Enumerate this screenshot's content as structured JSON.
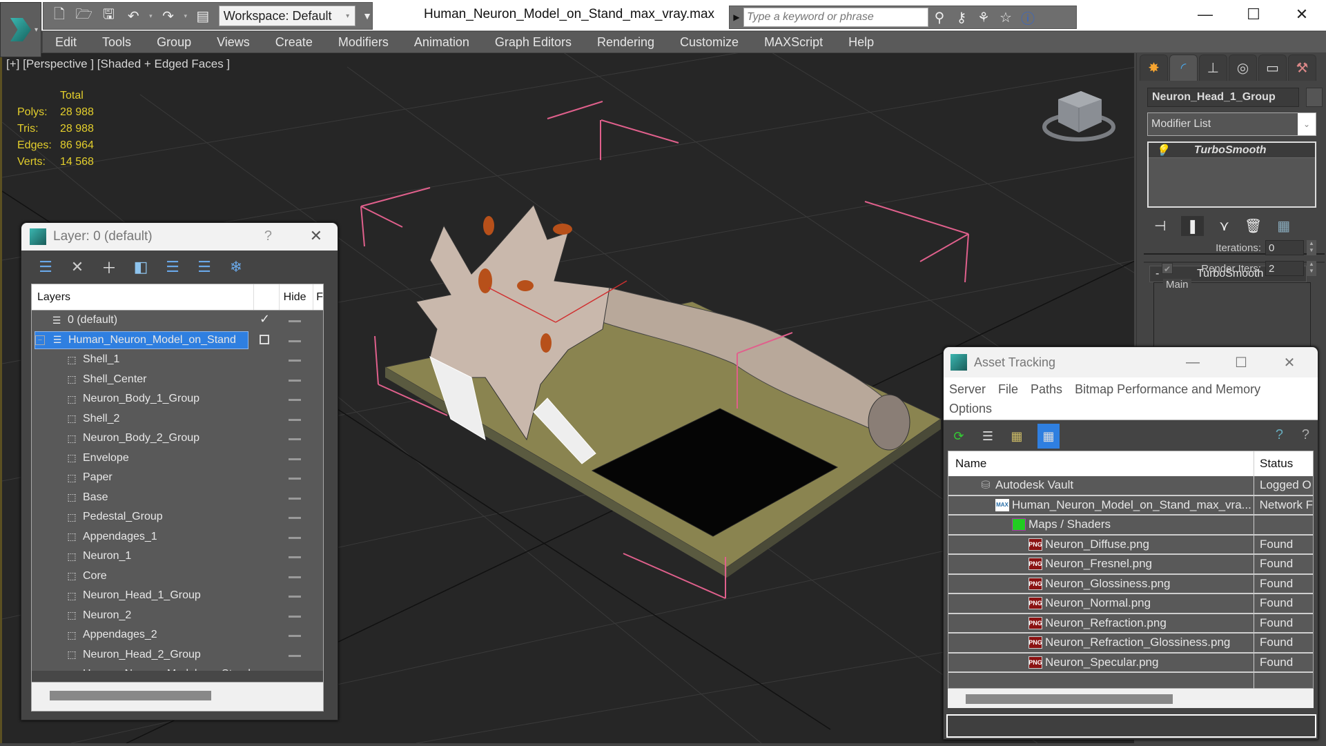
{
  "titlebar": {
    "workspace_label": "Workspace: Default",
    "document_title": "Human_Neuron_Model_on_Stand_max_vray.max",
    "search_placeholder": "Type a keyword or phrase",
    "minimize": "—",
    "maximize": "☐",
    "close": "✕"
  },
  "menubar": [
    "Edit",
    "Tools",
    "Group",
    "Views",
    "Create",
    "Modifiers",
    "Animation",
    "Graph Editors",
    "Rendering",
    "Customize",
    "MAXScript",
    "Help"
  ],
  "viewport": {
    "label": "[+] [Perspective ] [Shaded + Edged Faces ]",
    "stats": {
      "header": "Total",
      "rows": [
        {
          "label": "Polys:",
          "value": "28 988"
        },
        {
          "label": "Tris:",
          "value": "28 988"
        },
        {
          "label": "Edges:",
          "value": "86 964"
        },
        {
          "label": "Verts:",
          "value": "14 568"
        }
      ]
    },
    "colors": {
      "stats": "#e4cf2c",
      "selection_bracket": "#e0608c",
      "background": "#262626"
    }
  },
  "layer_panel": {
    "title": "Layer: 0 (default)",
    "help": "?",
    "close": "✕",
    "toolbar_icons": [
      "create-layer-icon",
      "delete-layer-icon",
      "add-to-layer-icon",
      "select-objects-icon",
      "select-layer-icon",
      "set-current-layer-icon",
      "freeze-layer-icon"
    ],
    "columns": {
      "layers": "Layers",
      "hide": "Hide",
      "freeze": "F"
    },
    "rows": [
      {
        "name": "0 (default)",
        "type": "layer",
        "current": true
      },
      {
        "name": "Human_Neuron_Model_on_Stand",
        "type": "layer",
        "selected": true,
        "expanded": true
      },
      {
        "name": "Shell_1",
        "type": "object"
      },
      {
        "name": "Shell_Center",
        "type": "object"
      },
      {
        "name": "Neuron_Body_1_Group",
        "type": "object"
      },
      {
        "name": "Shell_2",
        "type": "object"
      },
      {
        "name": "Neuron_Body_2_Group",
        "type": "object"
      },
      {
        "name": "Envelope",
        "type": "object"
      },
      {
        "name": "Paper",
        "type": "object"
      },
      {
        "name": "Base",
        "type": "object"
      },
      {
        "name": "Pedestal_Group",
        "type": "object"
      },
      {
        "name": "Appendages_1",
        "type": "object"
      },
      {
        "name": "Neuron_1",
        "type": "object"
      },
      {
        "name": "Core",
        "type": "object"
      },
      {
        "name": "Neuron_Head_1_Group",
        "type": "object"
      },
      {
        "name": "Neuron_2",
        "type": "object"
      },
      {
        "name": "Appendages_2",
        "type": "object"
      },
      {
        "name": "Neuron_Head_2_Group",
        "type": "object"
      },
      {
        "name": "Human_Neuron_Model_on_Stand",
        "type": "object"
      }
    ]
  },
  "command_panel": {
    "tabs": [
      "create-tab",
      "modify-tab",
      "hierarchy-tab",
      "motion-tab",
      "display-tab",
      "utilities-tab"
    ],
    "active_tab": "modify-tab",
    "object_name": "Neuron_Head_1_Group",
    "modifier_list_label": "Modifier List",
    "modifier_stack": [
      "TurboSmooth"
    ],
    "rollout_title": "TurboSmooth",
    "rollout_collapse": "-",
    "group_label": "Main",
    "iterations_label": "Iterations:",
    "iterations_value": "0",
    "render_iters_label": "Render Iters:",
    "render_iters_value": "2",
    "render_iters_checked": true
  },
  "asset_tracking": {
    "title": "Asset Tracking",
    "menu_row1": [
      "Server",
      "File",
      "Paths",
      "Bitmap Performance and Memory"
    ],
    "menu_row2": [
      "Options"
    ],
    "columns": {
      "name": "Name",
      "status": "Status"
    },
    "rows": [
      {
        "name": "Autodesk Vault",
        "status": "Logged O",
        "icon": "vault",
        "indent": 1
      },
      {
        "name": "Human_Neuron_Model_on_Stand_max_vra...",
        "status": "Network F",
        "icon": "max",
        "indent": 2
      },
      {
        "name": "Maps / Shaders",
        "status": "",
        "icon": "maps",
        "indent": 3
      },
      {
        "name": "Neuron_Diffuse.png",
        "status": "Found",
        "icon": "png",
        "indent": 4
      },
      {
        "name": "Neuron_Fresnel.png",
        "status": "Found",
        "icon": "png",
        "indent": 4
      },
      {
        "name": "Neuron_Glossiness.png",
        "status": "Found",
        "icon": "png",
        "indent": 4
      },
      {
        "name": "Neuron_Normal.png",
        "status": "Found",
        "icon": "png",
        "indent": 4
      },
      {
        "name": "Neuron_Refraction.png",
        "status": "Found",
        "icon": "png",
        "indent": 4
      },
      {
        "name": "Neuron_Refraction_Glossiness.png",
        "status": "Found",
        "icon": "png",
        "indent": 4
      },
      {
        "name": "Neuron_Specular.png",
        "status": "Found",
        "icon": "png",
        "indent": 4
      }
    ]
  }
}
